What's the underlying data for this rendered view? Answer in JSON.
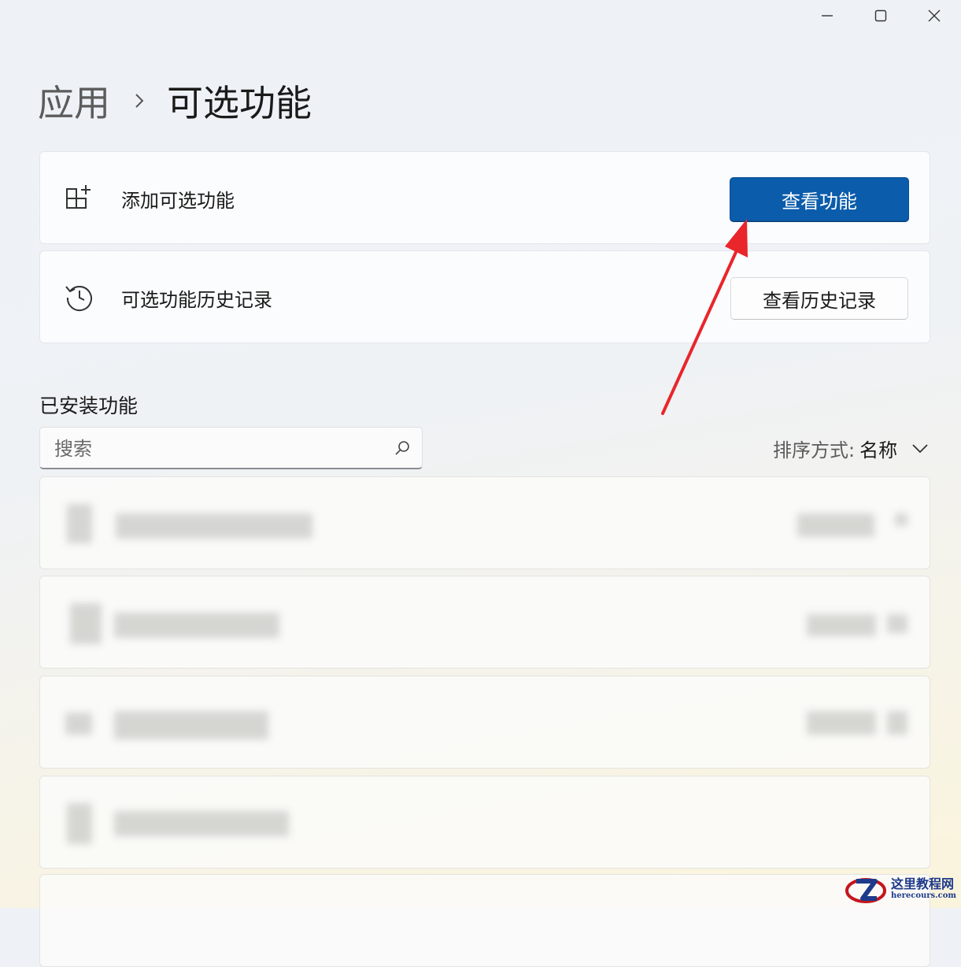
{
  "window": {
    "minimize_icon": "minimize-icon",
    "maximize_icon": "maximize-icon",
    "close_icon": "close-icon"
  },
  "breadcrumb": {
    "parent": "应用",
    "separator_icon": "chevron-right-icon",
    "current": "可选功能"
  },
  "add_feature": {
    "icon": "add-apps-icon",
    "label": "添加可选功能",
    "button_label": "查看功能"
  },
  "history": {
    "icon": "history-icon",
    "label": "可选功能历史记录",
    "button_label": "查看历史记录"
  },
  "installed": {
    "title": "已安装功能",
    "search_placeholder": "搜索",
    "search_value": "",
    "sort_label": "排序方式:",
    "sort_value": "名称"
  },
  "annotation": {
    "color": "#e8262b"
  },
  "watermark": {
    "title": "这里教程网",
    "url": "herecours.com"
  },
  "colors": {
    "accent": "#0b5cab"
  }
}
